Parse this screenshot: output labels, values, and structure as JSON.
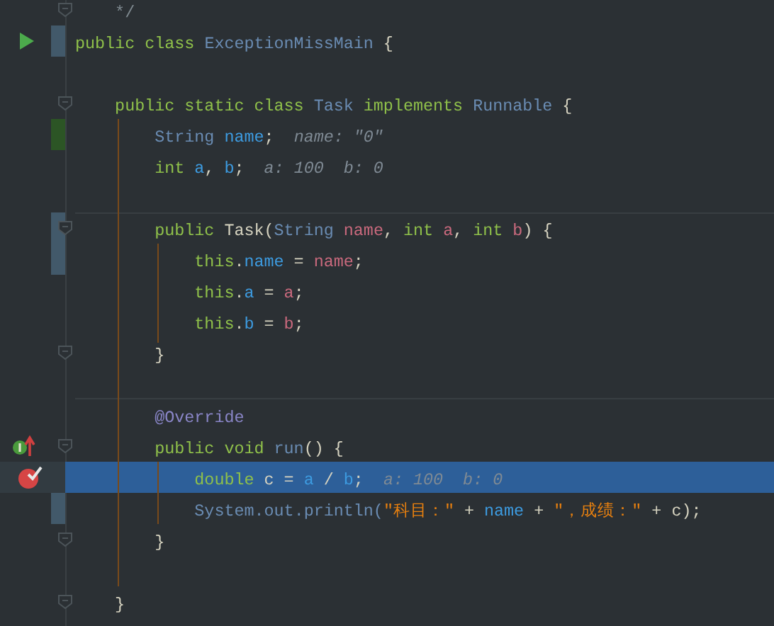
{
  "editor": {
    "lines": [
      {
        "selected": false,
        "tokens": [
          {
            "kind": "comment",
            "text": "    */"
          }
        ]
      },
      {
        "selected": false,
        "tokens": [
          {
            "kind": "keyword",
            "text": "public class "
          },
          {
            "kind": "type",
            "text": "ExceptionMissMain"
          },
          {
            "kind": "plain",
            "text": " {"
          }
        ]
      },
      {
        "selected": false
      },
      {
        "selected": false,
        "tokens": [
          {
            "kind": "keyword",
            "text": "    public static class "
          },
          {
            "kind": "type",
            "text": "Task"
          },
          {
            "kind": "keyword",
            "text": " implements "
          },
          {
            "kind": "type",
            "text": "Runnable"
          },
          {
            "kind": "plain",
            "text": " {"
          }
        ]
      },
      {
        "selected": false,
        "tokens": [
          {
            "kind": "type",
            "text": "        String "
          },
          {
            "kind": "field",
            "text": "name"
          },
          {
            "kind": "plain",
            "text": ";"
          },
          {
            "kind": "hint",
            "text": "  name: \"0\""
          }
        ]
      },
      {
        "selected": false,
        "tokens": [
          {
            "kind": "keyword",
            "text": "        int "
          },
          {
            "kind": "field",
            "text": "a"
          },
          {
            "kind": "plain",
            "text": ", "
          },
          {
            "kind": "field",
            "text": "b"
          },
          {
            "kind": "plain",
            "text": ";"
          },
          {
            "kind": "hint",
            "text": "  a: 100  b: 0"
          }
        ]
      },
      {
        "selected": false
      },
      {
        "selected": false,
        "tokens": [
          {
            "kind": "keyword",
            "text": "        public "
          },
          {
            "kind": "plain",
            "text": "Task("
          },
          {
            "kind": "type",
            "text": "String "
          },
          {
            "kind": "param",
            "text": "name"
          },
          {
            "kind": "plain",
            "text": ", "
          },
          {
            "kind": "keyword",
            "text": "int "
          },
          {
            "kind": "param",
            "text": "a"
          },
          {
            "kind": "plain",
            "text": ", "
          },
          {
            "kind": "keyword",
            "text": "int "
          },
          {
            "kind": "param",
            "text": "b"
          },
          {
            "kind": "plain",
            "text": ") {"
          }
        ]
      },
      {
        "selected": false,
        "tokens": [
          {
            "kind": "keyword",
            "text": "            this"
          },
          {
            "kind": "plain",
            "text": "."
          },
          {
            "kind": "field",
            "text": "name"
          },
          {
            "kind": "plain",
            "text": " = "
          },
          {
            "kind": "param",
            "text": "name"
          },
          {
            "kind": "plain",
            "text": ";"
          }
        ]
      },
      {
        "selected": false,
        "tokens": [
          {
            "kind": "keyword",
            "text": "            this"
          },
          {
            "kind": "plain",
            "text": "."
          },
          {
            "kind": "field",
            "text": "a"
          },
          {
            "kind": "plain",
            "text": " = "
          },
          {
            "kind": "param",
            "text": "a"
          },
          {
            "kind": "plain",
            "text": ";"
          }
        ]
      },
      {
        "selected": false,
        "tokens": [
          {
            "kind": "keyword",
            "text": "            this"
          },
          {
            "kind": "plain",
            "text": "."
          },
          {
            "kind": "field",
            "text": "b"
          },
          {
            "kind": "plain",
            "text": " = "
          },
          {
            "kind": "param",
            "text": "b"
          },
          {
            "kind": "plain",
            "text": ";"
          }
        ]
      },
      {
        "selected": false,
        "tokens": [
          {
            "kind": "plain",
            "text": "        }"
          }
        ]
      },
      {
        "selected": false
      },
      {
        "selected": false,
        "tokens": [
          {
            "kind": "annotation",
            "text": "        @Override"
          }
        ]
      },
      {
        "selected": false,
        "tokens": [
          {
            "kind": "keyword",
            "text": "        public void "
          },
          {
            "kind": "type",
            "text": "run"
          },
          {
            "kind": "plain",
            "text": "() {"
          }
        ]
      },
      {
        "selected": true,
        "tokens": [
          {
            "kind": "keyword",
            "text": "            double "
          },
          {
            "kind": "plain",
            "text": "c = "
          },
          {
            "kind": "field",
            "text": "a"
          },
          {
            "kind": "plain",
            "text": " / "
          },
          {
            "kind": "field",
            "text": "b"
          },
          {
            "kind": "plain",
            "text": ";"
          },
          {
            "kind": "hint",
            "text": "  a: 100  b: 0"
          }
        ]
      },
      {
        "selected": false,
        "tokens": [
          {
            "kind": "type",
            "text": "            System."
          },
          {
            "kind": "type",
            "text": "out"
          },
          {
            "kind": "type",
            "text": ".println("
          },
          {
            "kind": "string",
            "text": "\"科目：\""
          },
          {
            "kind": "plain",
            "text": " + "
          },
          {
            "kind": "field",
            "text": "name"
          },
          {
            "kind": "plain",
            "text": " + "
          },
          {
            "kind": "string",
            "text": "\"，成绩：\""
          },
          {
            "kind": "plain",
            "text": " + c);"
          }
        ]
      },
      {
        "selected": false,
        "tokens": [
          {
            "kind": "plain",
            "text": "        }"
          }
        ]
      },
      {
        "selected": false
      },
      {
        "selected": false,
        "tokens": [
          {
            "kind": "plain",
            "text": "    }"
          }
        ]
      }
    ]
  }
}
